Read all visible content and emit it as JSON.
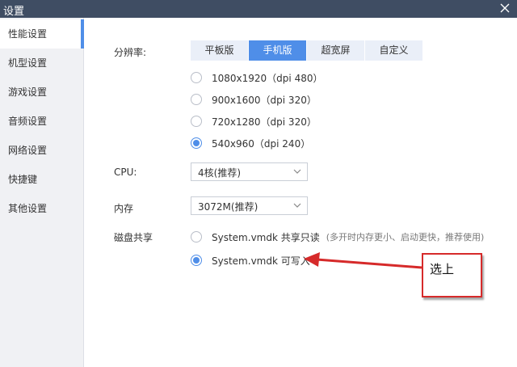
{
  "window": {
    "title": "设置"
  },
  "sidebar": {
    "items": [
      {
        "label": "性能设置",
        "active": true
      },
      {
        "label": "机型设置",
        "active": false
      },
      {
        "label": "游戏设置",
        "active": false
      },
      {
        "label": "音频设置",
        "active": false
      },
      {
        "label": "网络设置",
        "active": false
      },
      {
        "label": "快捷键",
        "active": false
      },
      {
        "label": "其他设置",
        "active": false
      }
    ]
  },
  "resolution": {
    "label": "分辨率:",
    "tabs": [
      "平板版",
      "手机版",
      "超宽屏",
      "自定义"
    ],
    "active_tab": "手机版",
    "options": [
      "1080x1920（dpi 480）",
      "900x1600（dpi 320）",
      "720x1280（dpi 320）",
      "540x960（dpi 240）"
    ],
    "selected": "540x960（dpi 240）"
  },
  "cpu": {
    "label": "CPU:",
    "value": "4核(推荐)"
  },
  "memory": {
    "label": "内存",
    "value": "3072M(推荐)"
  },
  "disk_share": {
    "label": "磁盘共享",
    "options": [
      {
        "text": "System.vmdk 共享只读",
        "hint": "(多开时内存更小、启动更快，推荐使用)",
        "checked": false
      },
      {
        "text": "System.vmdk 可写入",
        "hint": "",
        "checked": true
      }
    ]
  },
  "annotation": {
    "callout_text": "选上",
    "color": "#d62a2a"
  },
  "colors": {
    "accent": "#4f8ee8",
    "titlebar": "#3f4d63",
    "sidebar_bg": "#f0f1f4",
    "tab_bg": "#eaeff8"
  }
}
